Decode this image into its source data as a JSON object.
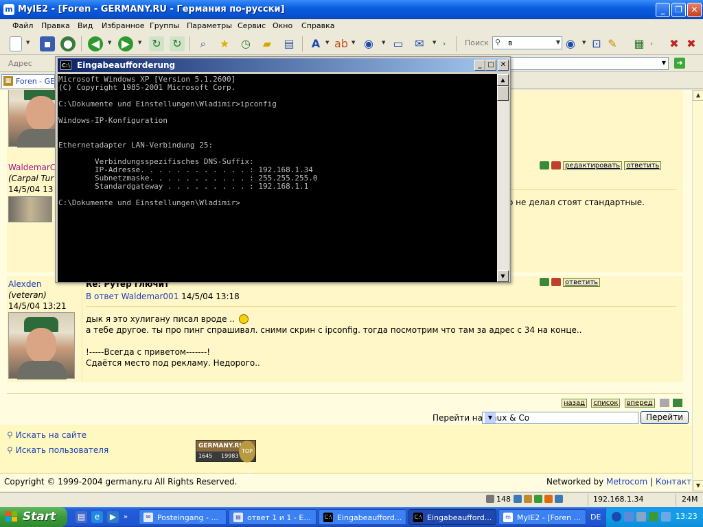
{
  "window": {
    "title": "MyIE2 - [Foren - GERMANY.RU - Германия по-русски]",
    "app_icon": "myie2-icon",
    "minimize": "_",
    "maximize": "❐",
    "close": "✕"
  },
  "menu": [
    "Файл",
    "Правка",
    "Вид",
    "Избранное",
    "Группы",
    "Параметры",
    "Сервис",
    "Окно",
    "Справка"
  ],
  "toolbar": {
    "search_label": "Поиск",
    "search_value": "в"
  },
  "address": {
    "label": "Адрес",
    "value": ""
  },
  "tabs": [
    {
      "label": "Foren - GE..."
    }
  ],
  "cmd": {
    "title": "Eingabeaufforderung",
    "lines": [
      "Microsoft Windows XP [Version 5.1.2600]",
      "(C) Copyright 1985-2001 Microsoft Corp.",
      "",
      "C:\\Dokumente und Einstellungen\\Wladimir>ipconfig",
      "",
      "Windows-IP-Konfiguration",
      "",
      "",
      "Ethernetadapter LAN-Verbindung 25:",
      "",
      "        Verbindungsspezifisches DNS-Suffix:",
      "        IP-Adresse. . . . . . . . . . . . : 192.168.1.34",
      "        Subnetzmaske. . . . . . . . . . . : 255.255.255.0",
      "        Standardgateway . . . . . . . . . : 192.168.1.1",
      "",
      "C:\\Dokumente und Einstellungen\\Wladimir>"
    ]
  },
  "post1": {
    "username": "WaldemarC",
    "user_title": "(Carpal Tur",
    "date": "14/5/04 13",
    "actions": {
      "edit": "редактировать",
      "reply": "ответить"
    },
    "text_tail": "о не делал стоят стандартные."
  },
  "post2": {
    "username": "Alexden",
    "user_title": "(veteran)",
    "date": "14/5/04 13:21",
    "title": "Re: Рутер глючит",
    "reply_prefix": "В ответ",
    "reply_user": "Waldemar001",
    "reply_date": "14/5/04 13:18",
    "lines": [
      "дык я это хулигану писал вроде ..",
      "а тебе другое. ты про пинг спрашивал. сними скрин с ipconfig. тогда посмотрим что там за адрес с 34 на конце..",
      "",
      "!-----Всегда с приветом-------!",
      "Сдаётся место под рекламу. Недорого.."
    ],
    "actions": {
      "reply": "ответить"
    }
  },
  "nav": {
    "back": "назад",
    "list": "список",
    "forward": "вперед"
  },
  "jump": {
    "label": "Перейти на",
    "selected": "Linux & Co",
    "button": "Перейти"
  },
  "footer": {
    "search_site": "Искать на сайте",
    "search_user": "Искать пользователя",
    "badge_title": "GERMANY.RU",
    "badge_n1": "1645",
    "badge_n2": "19983",
    "badge_top": "TOP 100",
    "copyright": "Copyright © 1999-2004 germany.ru All Rights Reserved.",
    "networked_prefix": "Networked by",
    "networked_link": "Metrocom",
    "separator": "|",
    "contact": "Контакт"
  },
  "status": {
    "count": "148",
    "ip": "192.168.1.34",
    "mem": "24M"
  },
  "taskbar": {
    "start": "Start",
    "tasks": [
      {
        "label": "Posteingang - ...",
        "active": false
      },
      {
        "label": "ответ 1 и 1 - E...",
        "active": false
      },
      {
        "label": "Eingabeaufford...",
        "active": false
      },
      {
        "label": "Eingabeaufford...",
        "active": true
      },
      {
        "label": "MyIE2 - [Foren ...",
        "active": false
      }
    ],
    "lang": "DE",
    "clock": "13:23"
  }
}
